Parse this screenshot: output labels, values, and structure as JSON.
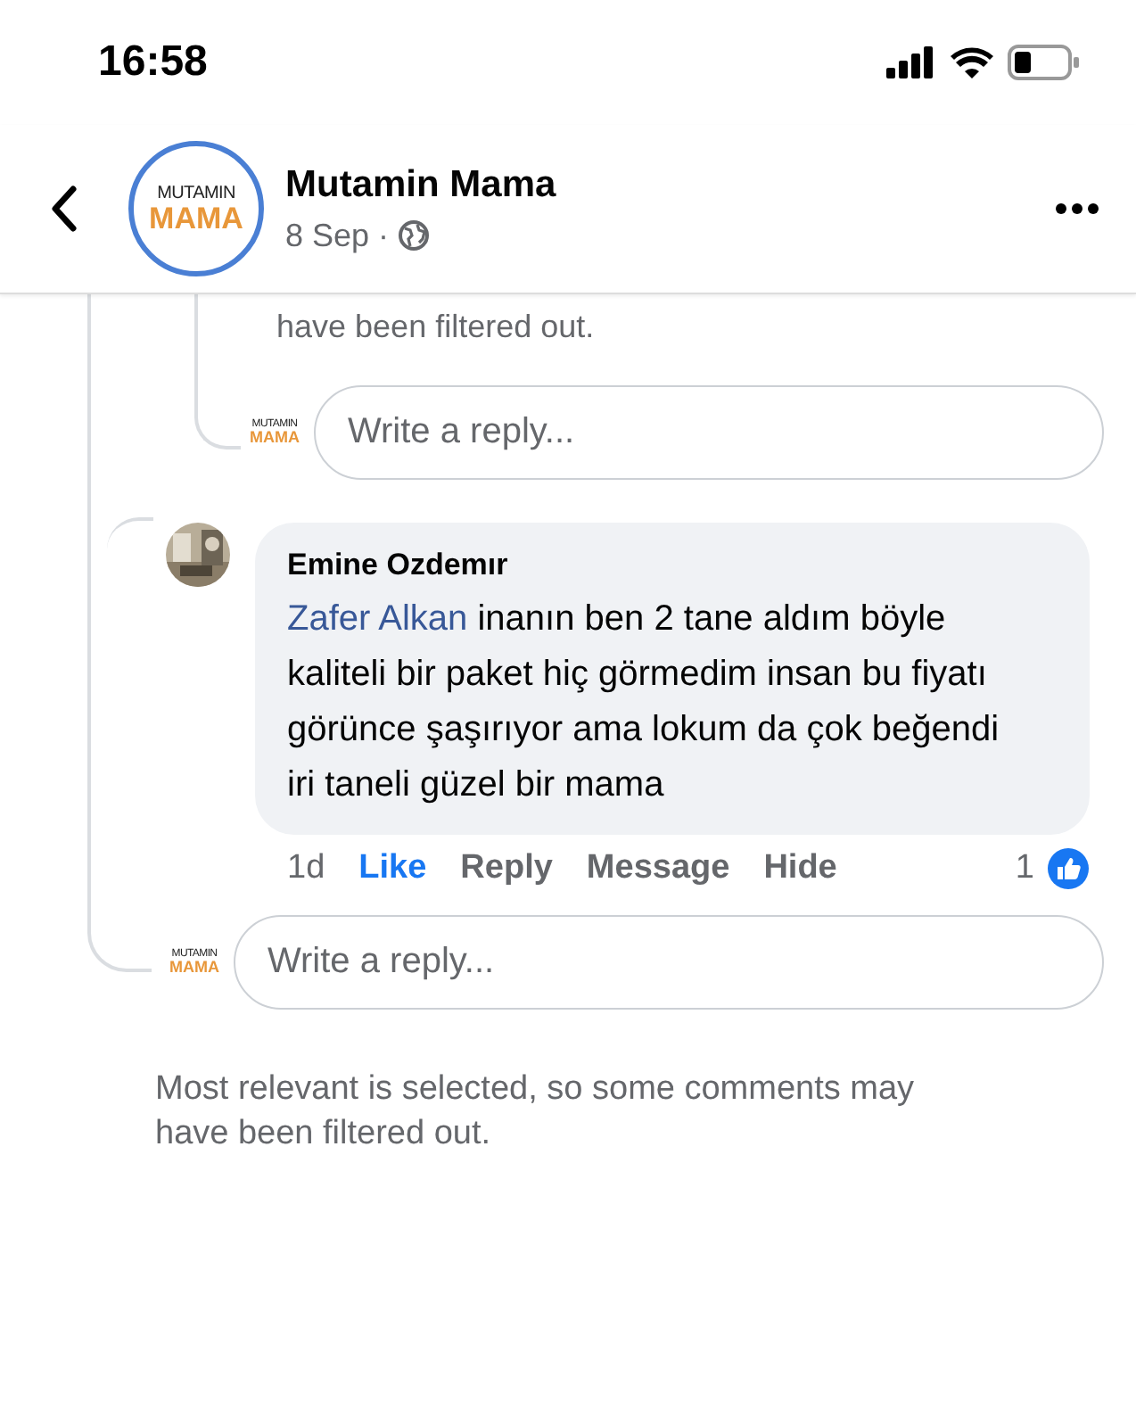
{
  "status_bar": {
    "time": "16:58"
  },
  "header": {
    "page_name": "Mutamin Mama",
    "date": "8 Sep",
    "separator": "·",
    "logo": {
      "top": "MUTAMIN",
      "bottom": "MAMA"
    }
  },
  "thread": [
    {
      "kind": "note",
      "text": "have been filtered out."
    },
    {
      "kind": "reply_box",
      "placeholder": "Write a reply...",
      "logo": {
        "top": "MUTAMIN",
        "bottom": "MAMA"
      }
    },
    {
      "kind": "comment",
      "author": "Emine Ozdemır",
      "mention": "Zafer Alkan",
      "text": "inanın ben 2 tane aldım böyle kaliteli bir paket hiç görmedim insan bu fiyatı görünce şaşırıyor ama lokum da çok beğendi iri taneli güzel bir mama",
      "time": "1d",
      "actions": [
        {
          "label": "Like",
          "selected": true
        },
        {
          "label": "Reply",
          "selected": false
        },
        {
          "label": "Message",
          "selected": false
        },
        {
          "label": "Hide",
          "selected": false
        }
      ],
      "reaction_count": "1"
    },
    {
      "kind": "reply_box",
      "placeholder": "Write a reply...",
      "logo": {
        "top": "MUTAMIN",
        "bottom": "MAMA"
      }
    }
  ],
  "footer_note": "Most relevant is selected, so some comments may have been filtered out."
}
